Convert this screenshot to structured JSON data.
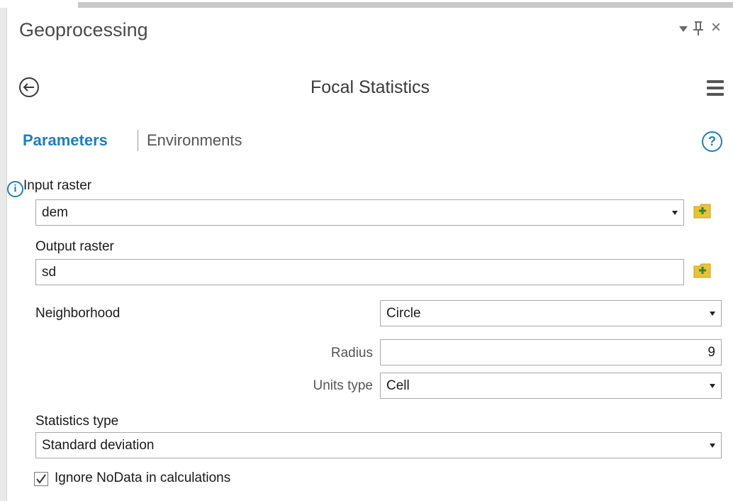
{
  "window": {
    "title": "Geoprocessing",
    "pin_glyph": "q",
    "close_glyph": "×"
  },
  "tool": {
    "title": "Focal Statistics"
  },
  "tabs": {
    "parameters": "Parameters",
    "environments": "Environments",
    "help": "?"
  },
  "params": {
    "input_raster": {
      "label": "Input raster",
      "value": "dem"
    },
    "output_raster": {
      "label": "Output raster",
      "value": "sd"
    },
    "neighborhood": {
      "label": "Neighborhood",
      "value": "Circle"
    },
    "radius": {
      "label": "Radius",
      "value": "9"
    },
    "units_type": {
      "label": "Units type",
      "value": "Cell"
    },
    "statistics_type": {
      "label": "Statistics type",
      "value": "Standard deviation"
    },
    "ignore_nodata": {
      "label": "Ignore NoData in calculations",
      "checked": true
    }
  },
  "icons": {
    "info": "i",
    "colors": {
      "accent": "#1f7ec1",
      "folder": "#e8c23a",
      "plus": "#2e8b2e"
    }
  }
}
